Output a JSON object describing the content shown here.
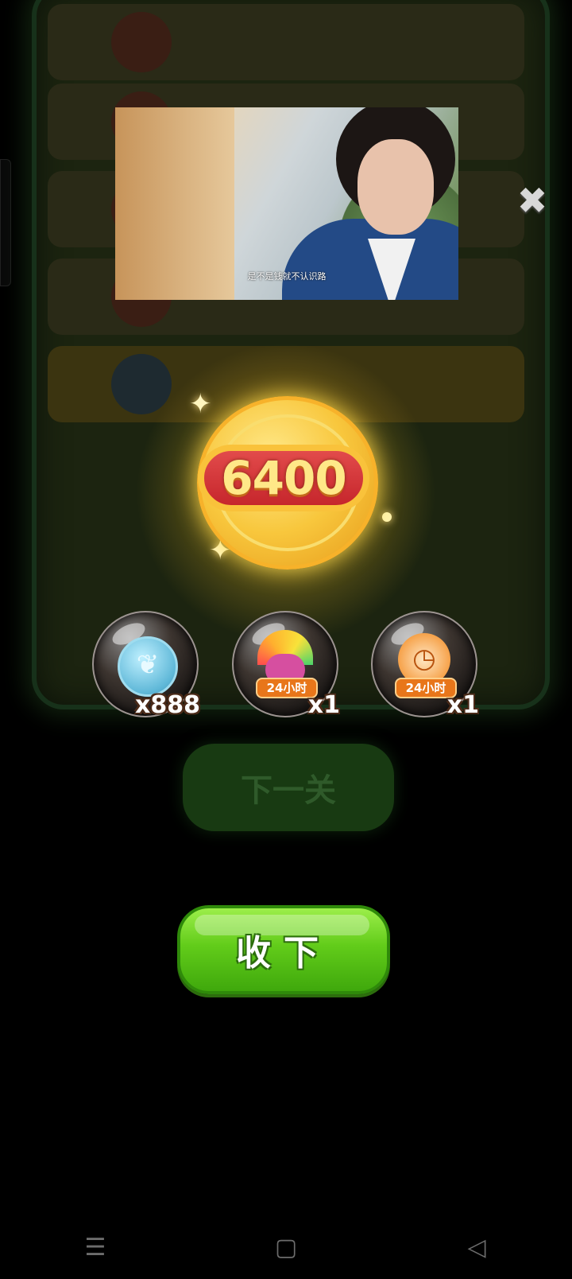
{
  "background": {
    "next_button_label": "下一关"
  },
  "video_ad": {
    "subtitle": "是不是钱就不认识路"
  },
  "reward": {
    "score": "6400",
    "items": [
      {
        "icon": "leaf-coin-icon",
        "count": "x888",
        "badge": ""
      },
      {
        "icon": "rainbow-owl-icon",
        "count": "x1",
        "badge": "24小时"
      },
      {
        "icon": "clock-boost-icon",
        "count": "x1",
        "badge": "24小时"
      }
    ]
  },
  "collect_button_label": "收下",
  "close_icon_glyph": "✖",
  "navbar": {
    "menu_glyph": "☰",
    "home_glyph": "▢",
    "back_glyph": "◁"
  }
}
